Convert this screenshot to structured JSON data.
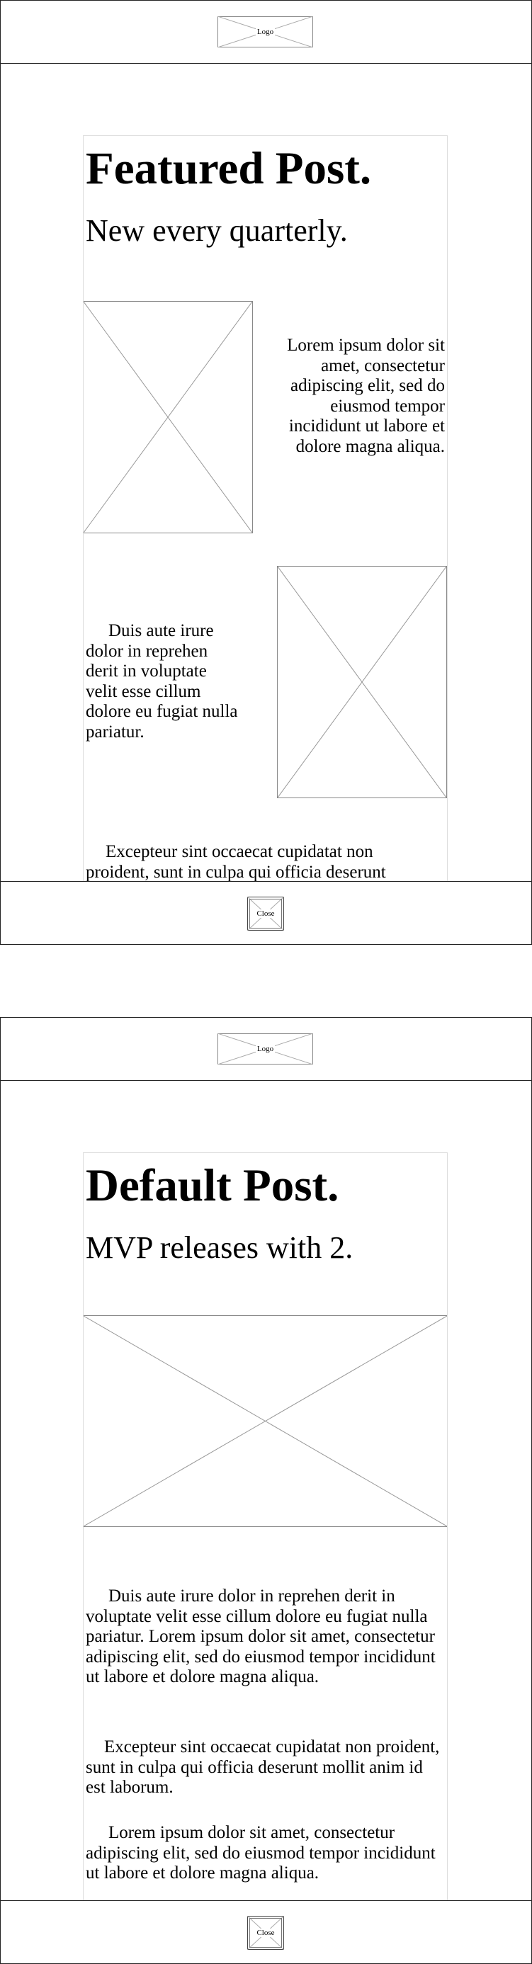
{
  "featured_screen": {
    "header": {
      "logo_label": "Logo"
    },
    "post": {
      "title": "Featured Post.",
      "subtitle": "New every quarterly.",
      "paragraph_right": "Lorem ipsum dolor sit amet, consectetur adipiscing elit, sed do eiusmod tempor incididunt ut labore et dolore magna aliqua.",
      "paragraph_left": "Duis aute irure dolor in reprehen derit in voluptate velit esse cillum dolore eu fugiat nulla pariatur.",
      "paragraph_bottom": "Excepteur sint occaecat cupidatat non proident, sunt in culpa qui officia deserunt"
    },
    "footer": {
      "close_label": "Close"
    }
  },
  "default_screen": {
    "header": {
      "logo_label": "Logo"
    },
    "post": {
      "title": "Default Post.",
      "subtitle": "MVP releases with 2.",
      "paragraph_1": "Duis aute irure dolor in reprehen derit in voluptate velit esse cillum dolore eu fugiat nulla pariatur. Lorem ipsum dolor sit amet, consectetur adipiscing elit, sed do eiusmod tempor incididunt ut labore et dolore magna aliqua.",
      "paragraph_2": "Excepteur sint occaecat cupidatat non proident, sunt in culpa qui officia deserunt mollit anim id est laborum.",
      "paragraph_3": "Lorem ipsum dolor sit amet, consectetur adipiscing elit, sed do eiusmod tempor incididunt ut labore et dolore magna aliqua."
    },
    "footer": {
      "close_label": "Close"
    }
  }
}
